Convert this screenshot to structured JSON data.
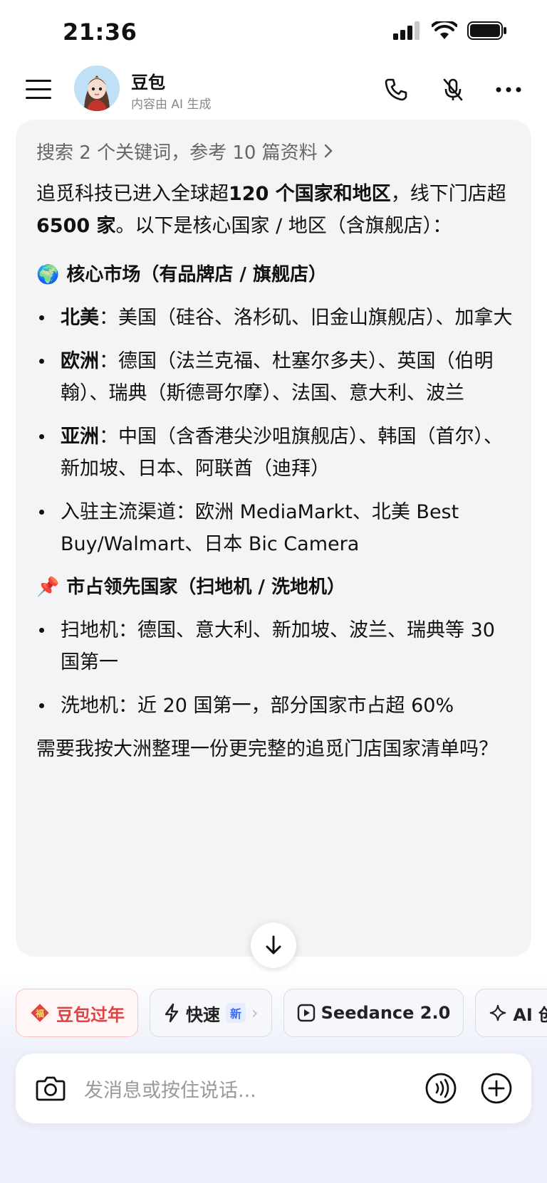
{
  "status_bar": {
    "time": "21:36"
  },
  "header": {
    "title": "豆包",
    "subtitle": "内容由 AI 生成",
    "icons": [
      "menu-icon",
      "phone-icon",
      "mic-off-icon",
      "more-icon"
    ]
  },
  "message": {
    "search_ref": "搜索 2 个关键词，参考 10 篇资料",
    "intro": {
      "p1": "追觅科技已进入全球超",
      "b1": "120 个国家和地区",
      "p2": "，线下门店超",
      "b2": "6500 家",
      "p3": "。以下是核心国家 / 地区（含旗舰店）："
    },
    "section1": {
      "emoji": "🌍",
      "title": "核心市场（有品牌店 / 旗舰店）",
      "items": [
        {
          "bold": "北美",
          "text": "：美国（硅谷、洛杉矶、旧金山旗舰店）、加拿大"
        },
        {
          "bold": "欧洲",
          "text": "：德国（法兰克福、杜塞尔多夫）、英国（伯明翰）、瑞典（斯德哥尔摩）、法国、意大利、波兰"
        },
        {
          "bold": "亚洲",
          "text": "：中国（含香港尖沙咀旗舰店）、韩国（首尔）、新加坡、日本、阿联酋（迪拜）"
        },
        {
          "bold": "",
          "text": "入驻主流渠道：欧洲 MediaMarkt、北美 Best Buy/Walmart、日本 Bic Camera"
        }
      ]
    },
    "section2": {
      "emoji": "📌",
      "title": "市占领先国家（扫地机 / 洗地机）",
      "items": [
        {
          "text": "扫地机：德国、意大利、新加坡、波兰、瑞典等 30 国第一"
        },
        {
          "text": "洗地机：近 20 国第一，部分国家市占超 60%"
        }
      ]
    },
    "closing": "需要我按大洲整理一份更完整的追觅门店国家清单吗？"
  },
  "chips": [
    {
      "label": "豆包过年",
      "icon": "fu-icon"
    },
    {
      "label": "快速",
      "badge": "新",
      "icon": "lightning-icon"
    },
    {
      "label": "Seedance 2.0",
      "icon": "play-icon"
    },
    {
      "label": "AI 创",
      "icon": "sparkle-icon"
    }
  ],
  "input": {
    "placeholder": "发消息或按住说话..."
  },
  "colors": {
    "accent_blue": "#3b6cf5",
    "festive_red": "#e04343",
    "card_bg": "#f4f4f6"
  }
}
